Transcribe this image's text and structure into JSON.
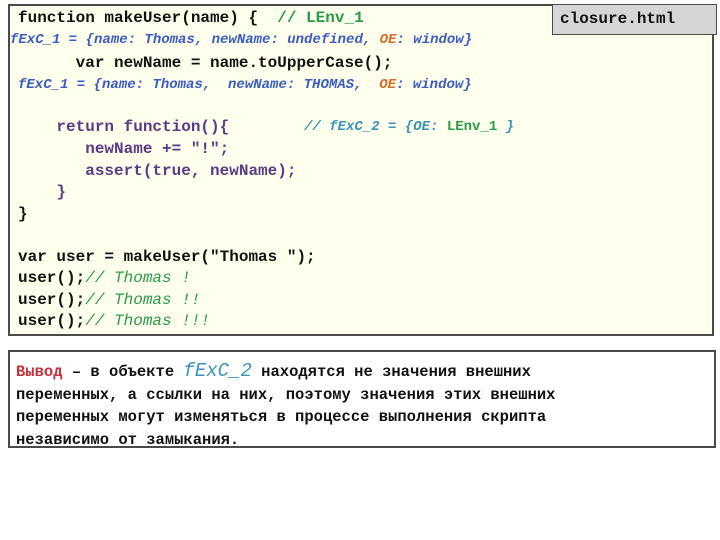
{
  "file_tab": {
    "label": "closure.html"
  },
  "code": {
    "line1": {
      "code": "function makeUser(name) {  ",
      "comment": "// LEnv_1"
    },
    "ann1": {
      "prefix": "fExC_1 = {name: Thomas, newName: undefined, ",
      "oe_key": "OE",
      "suffix": ": window}"
    },
    "line2": {
      "code": "      var newName = name.toUpperCase();"
    },
    "ann2": {
      "prefix": "fExC_1 = {name: Thomas,  newName: THOMAS,  ",
      "oe_key": "OE",
      "suffix": ": window}"
    },
    "line3": {
      "code": "    return function(){",
      "comment_prefix": "// fExC_2 = {OE: ",
      "comment_link": "LEnv_1",
      "comment_suffix": " }"
    },
    "line4": {
      "code": "       newName += \"!\";"
    },
    "line5": {
      "code": "       assert(true, newName);"
    },
    "line6": {
      "code": "    }"
    },
    "line7": {
      "code": "}"
    },
    "line8": {
      "code": "var user = makeUser(\"Thomas \");"
    },
    "calls": [
      {
        "code": "user();",
        "comment": "// Thomas !"
      },
      {
        "code": "user();",
        "comment": "// Thomas !!"
      },
      {
        "code": "user();",
        "comment": "// Thomas !!!"
      }
    ]
  },
  "note": {
    "label": "Вывод",
    "line1_a": " – в объекте ",
    "highlight": "fExC_2",
    "line1_b": " находятся не значения внешних",
    "line2": "переменных, а ссылки на них, поэтому значения этих внешних",
    "line3": "переменных могут изменяться в процессе выполнения скрипта",
    "line4": "независимо от замыкания."
  },
  "colors": {
    "code_background": "#ffffee",
    "tab_background": "#d6d6d6",
    "comment_green": "#2a9a4a",
    "annotation_blue": "#3a5bc0",
    "annotation_teal": "#3a92b8",
    "oe_orange": "#d86a28",
    "inner_purple": "#5b3a86",
    "note_red": "#c8323a"
  }
}
